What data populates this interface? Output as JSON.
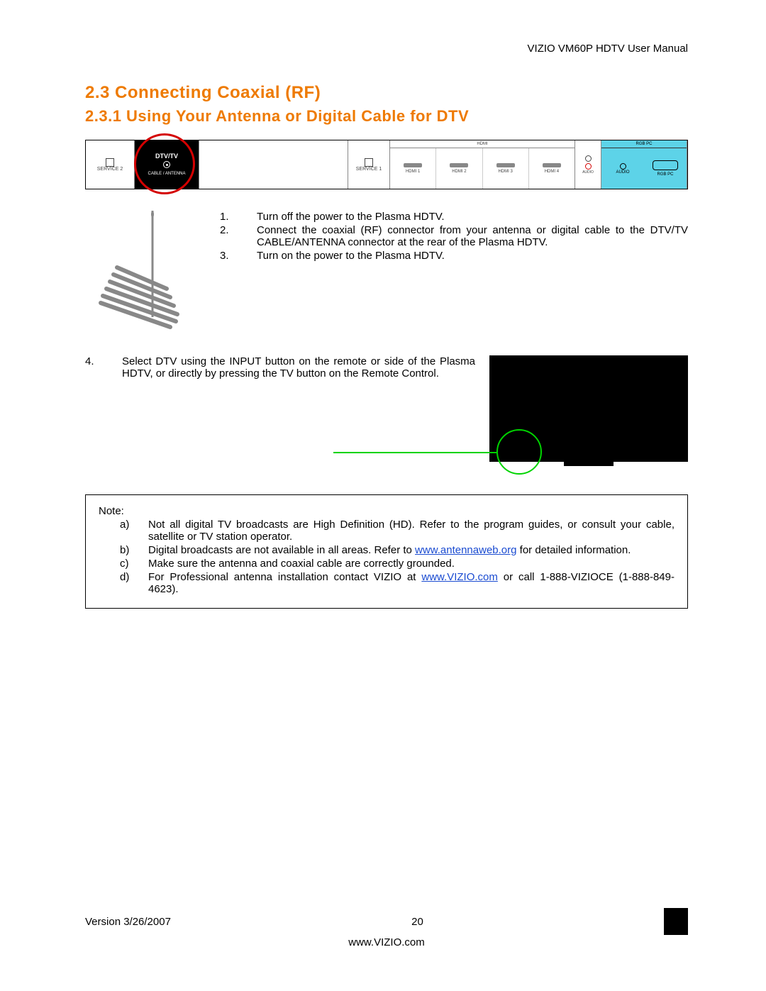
{
  "header": {
    "title": "VIZIO VM60P HDTV User Manual"
  },
  "headings": {
    "h1": "2.3 Connecting Coaxial (RF)",
    "h2": "2.3.1 Using Your Antenna or Digital Cable for DTV"
  },
  "panel": {
    "service2": "SERVICE 2",
    "dtv_title": "DTV/TV",
    "dtv_sub": "CABLE / ANTENNA",
    "service1": "SERVICE 1",
    "hdmi_group": "HDMI",
    "hdmi": [
      "HDMI 1",
      "HDMI 2",
      "HDMI 3",
      "HDMI 4"
    ],
    "audio_top": "L ●",
    "audio_bot": "R ●",
    "audio_lbl": "AUDIO",
    "rgb_group": "RGB PC",
    "rgb_audio": "AUDIO",
    "rgb_port": "RGB PC"
  },
  "steps": [
    {
      "n": "1.",
      "t": "Turn off the power to the Plasma HDTV."
    },
    {
      "n": "2.",
      "t": "Connect the coaxial (RF) connector from your antenna or digital cable to the DTV/TV CABLE/ANTENNA connector at the rear of the Plasma HDTV."
    },
    {
      "n": "3.",
      "t": "Turn on the power to the Plasma HDTV."
    }
  ],
  "step4": {
    "n": "4.",
    "t": "Select DTV using the INPUT button on the remote or side of the Plasma HDTV, or directly by pressing the TV button on the Remote Control."
  },
  "notes": {
    "title": "Note:",
    "items": [
      {
        "l": "a)",
        "t": "Not all digital TV broadcasts are High Definition (HD).  Refer to the program guides, or consult your cable, satellite or TV station operator."
      },
      {
        "l": "b)",
        "pre": "Digital broadcasts are not available in all areas.  Refer to ",
        "link": "www.antennaweb.org",
        "post": " for detailed information."
      },
      {
        "l": "c)",
        "t": "Make sure the antenna and coaxial cable are correctly grounded."
      },
      {
        "l": "d)",
        "pre": "For Professional antenna installation contact VIZIO at ",
        "link": "www.VIZIO.com",
        "post": " or call 1-888-VIZIOCE (1-888-849-4623)."
      }
    ]
  },
  "footer": {
    "version": "Version 3/26/2007",
    "page": "20",
    "url": "www.VIZIO.com"
  }
}
